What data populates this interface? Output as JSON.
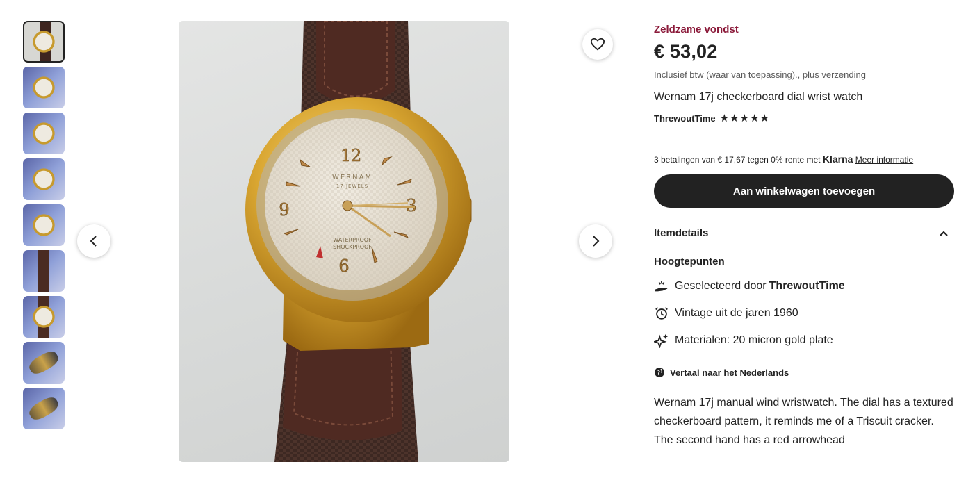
{
  "listing": {
    "badge": "Zeldzame vondst",
    "price": "€ 53,02",
    "vat_text": "Inclusief btw (waar van toepassing).,",
    "shipping_link": "plus verzending",
    "title": "Wernam 17j checkerboard dial wrist watch",
    "shop_name": "ThrewoutTime",
    "rating_stars": "★★★★★",
    "klarna_text": "3 betalingen van € 17,67 tegen 0% rente met",
    "klarna_brand": "Klarna",
    "klarna_link": "Meer informatie",
    "add_to_cart": "Aan winkelwagen toevoegen",
    "item_details": "Itemdetails",
    "highlights_title": "Hoogtepunten",
    "highlights": [
      {
        "icon": "hand-sparkle-icon",
        "text": "Geselecteerd door",
        "bold": "ThrewoutTime"
      },
      {
        "icon": "alarm-clock-icon",
        "text": "Vintage uit de jaren 1960"
      },
      {
        "icon": "sparkles-icon",
        "text": "Materialen: 20 micron gold plate"
      }
    ],
    "translate": "Vertaal naar het Nederlands",
    "description": "Wernam 17j manual wind wristwatch. The dial has a textured checkerboard pattern, it reminds me of a Triscuit cracker. The second hand has a red arrowhead"
  },
  "image": {
    "dial_brand": "WERNAM",
    "dial_jewels": "17 JEWELS",
    "dial_line1": "WATERPROOF",
    "dial_line2": "SHOCKPROOF",
    "numerals": [
      "12",
      "3",
      "6",
      "9"
    ]
  },
  "thumbnails": [
    "watch-front",
    "dial-closeup",
    "movement",
    "movement-ruler",
    "dial-angle",
    "side-ruler",
    "strap-back",
    "case-edge",
    "case-profile"
  ],
  "colors": {
    "accent_rare": "#8b1a3a",
    "button": "#222222"
  }
}
